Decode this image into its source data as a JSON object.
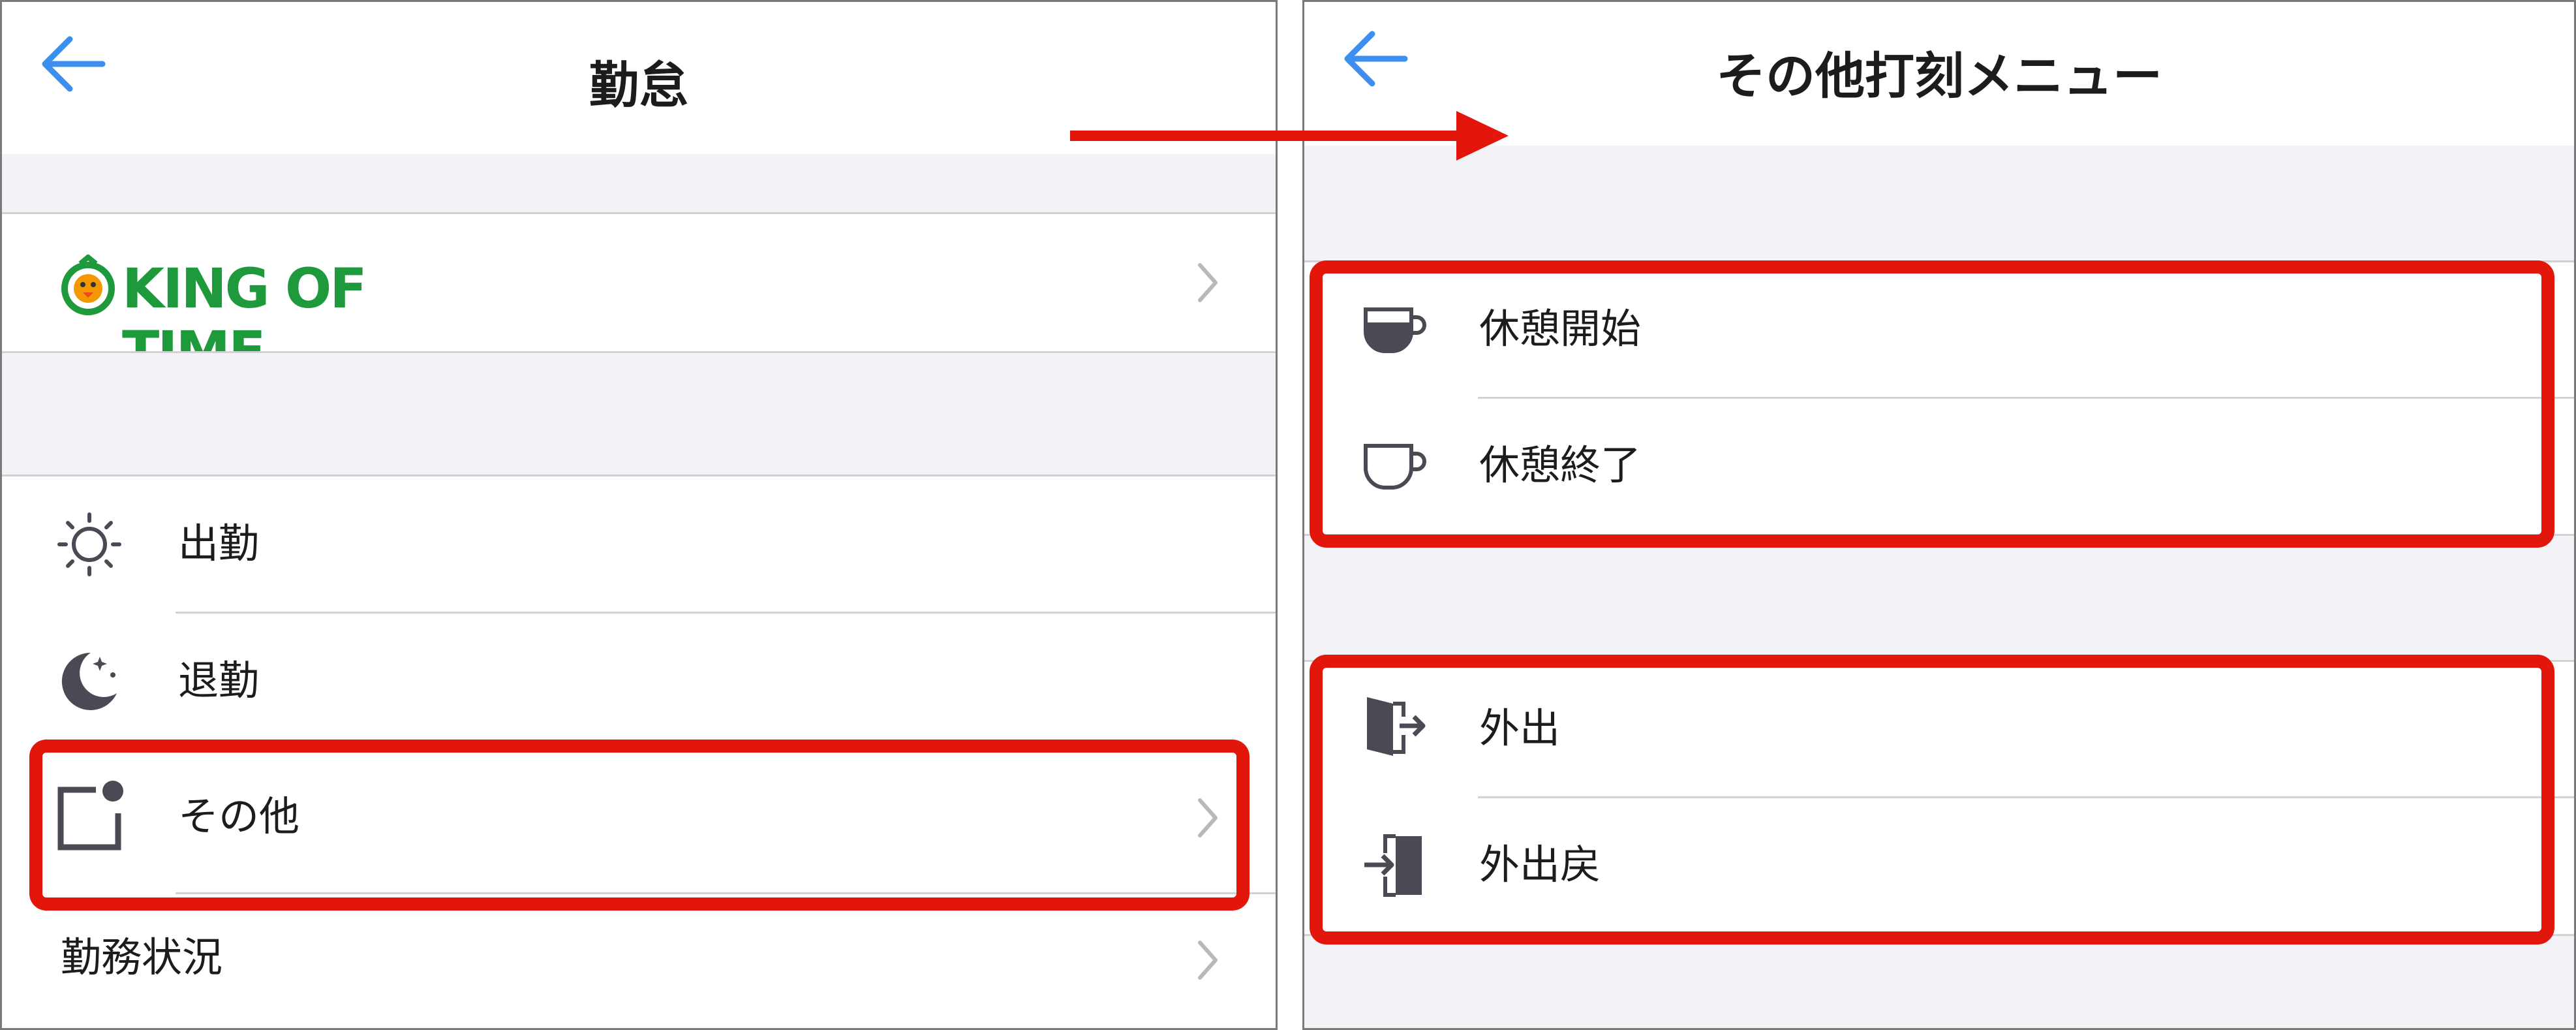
{
  "left_screen": {
    "title": "勤怠",
    "logo_text": "KING OF TIME",
    "items": [
      {
        "label": "出勤",
        "icon": "sun-icon"
      },
      {
        "label": "退勤",
        "icon": "moon-icon"
      },
      {
        "label": "その他",
        "icon": "other-notification-icon"
      },
      {
        "label": "勤務状況"
      }
    ]
  },
  "right_screen": {
    "title": "その他打刻メニュー",
    "items": [
      {
        "label": "休憩開始",
        "icon": "cup-filled-icon"
      },
      {
        "label": "休憩終了",
        "icon": "cup-empty-icon"
      },
      {
        "label": "外出",
        "icon": "door-exit-icon"
      },
      {
        "label": "外出戻",
        "icon": "door-enter-icon"
      }
    ]
  },
  "colors": {
    "accent": "#3d8fef",
    "highlight": "#e3160b",
    "logo_green": "#1e9a3c",
    "logo_orange": "#f39800",
    "group_bg": "#f2f2f7",
    "icon_gray": "#4a4a55"
  }
}
